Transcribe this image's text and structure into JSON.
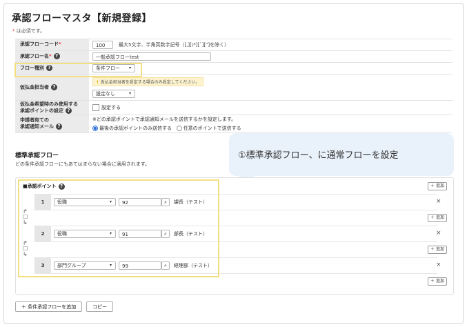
{
  "page": {
    "title": "承認フローマスタ【新規登録】",
    "required_mark": "*",
    "required_note": "は必須です。"
  },
  "form": {
    "flow_code": {
      "label": "承認フローコード",
      "value": "100",
      "hint": "最大5文字、半角英数字記号（[,][\\*][`][\"]を除く）"
    },
    "flow_name": {
      "label": "承認フロー名",
      "value": "一般承認フローtest"
    },
    "flow_type": {
      "label": "フロー種別",
      "value": "条件フロー"
    },
    "temp_payer": {
      "label": "仮払金担当者",
      "warning": "仮払金担当者を設定する場合のみ設定してください。",
      "value": "設定なし"
    },
    "temp_only": {
      "label_line1": "仮払金希望時のみ使用する",
      "label_line2": "承認ポイントの設定",
      "checkbox_label": "設定する"
    },
    "notify": {
      "label_line1": "申請者宛ての",
      "label_line2": "承認通知メール",
      "hint": "※どの承認ポイントで承認通知メールを送信するかを設定します。",
      "option1": "最後の承認ポイントのみ送信する",
      "option2": "任意のポイントで送信する"
    }
  },
  "callout": {
    "text": "①標準承認フロー、に通常フローを設定"
  },
  "standard_flow": {
    "title": "標準承認フロー",
    "description": "どの条件承認フローにもあてはまらない場合に適用されます。",
    "approval_point_label": "■承認ポイント",
    "add_label": "＋ 追加",
    "close_label": "×",
    "steps": [
      {
        "num": "1",
        "type": "役職",
        "code": "92",
        "name": "課長（テスト）"
      },
      {
        "num": "2",
        "type": "役職",
        "code": "91",
        "name": "部長（テスト）"
      },
      {
        "num": "3",
        "type": "部門グループ",
        "code": "99",
        "name": "経理部（テスト）"
      }
    ]
  },
  "buttons": {
    "add_conditional_flow": "＋ 条件承認フローを追加",
    "copy": "コピー"
  }
}
